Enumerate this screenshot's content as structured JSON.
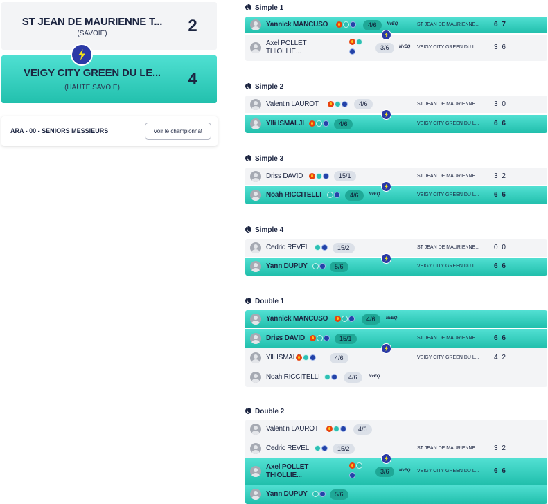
{
  "home_team": {
    "name": "ST JEAN DE MAURIENNE T...",
    "region": "(SAVOIE)",
    "score": "2"
  },
  "away_team": {
    "name": "VEIGY CITY GREEN DU LE...",
    "region": "(HAUTE SAVOIE)",
    "score": "4"
  },
  "championship": {
    "label": "ARA - 00 - SENIORS MESSIEURS",
    "button": "Voir le championnat"
  },
  "clubs": {
    "home": "ST JEAN DE MAURIENNE TENNIS",
    "away": "VEIGY CITY GREEN DU LEMAN"
  },
  "icons": {
    "badge": "lightning-bolt-icon",
    "fire": "fire-icon",
    "teal": "teal-circle-icon",
    "blue": "blue-circle-icon",
    "sport": "tennis-ball-icon"
  },
  "colors": {
    "winner": "#2ad0be",
    "badge": "#2b3aa7",
    "neutral": "#f3f4f6"
  },
  "matches": [
    {
      "title": "Simple 1",
      "players": [
        {
          "name": "Yannick MANCUSO",
          "rank": "4/6",
          "nveq": "NvEQ",
          "icons": [
            "fire",
            "teal",
            "blue"
          ]
        },
        {
          "name": "Axel POLLET THIOLLIE...",
          "rank": "3/6",
          "nveq": "NvEQ",
          "icons": [
            "fire",
            "teal",
            "blue"
          ]
        }
      ],
      "sets": {
        "top": "6 7",
        "bottom": "3 6"
      }
    },
    {
      "title": "Simple 2",
      "players": [
        {
          "name": "Valentin LAUROT",
          "rank": "4/6",
          "nveq": "",
          "icons": [
            "fire",
            "teal",
            "blue"
          ]
        },
        {
          "name": "Ylli ISMALJI",
          "rank": "4/6",
          "nveq": "",
          "icons": [
            "fire",
            "teal",
            "blue"
          ]
        }
      ],
      "sets": {
        "top": "3 0",
        "bottom": "6 6"
      }
    },
    {
      "title": "Simple 3",
      "players": [
        {
          "name": "Driss DAVID",
          "rank": "15/1",
          "nveq": "",
          "icons": [
            "fire",
            "teal",
            "blue"
          ]
        },
        {
          "name": "Noah RICCITELLI",
          "rank": "4/6",
          "nveq": "NvEQ",
          "icons": [
            "teal",
            "blue"
          ]
        }
      ],
      "sets": {
        "top": "3 2",
        "bottom": "6 6"
      }
    },
    {
      "title": "Simple 4",
      "players": [
        {
          "name": "Cedric REVEL",
          "rank": "15/2",
          "nveq": "",
          "icons": [
            "teal",
            "blue"
          ]
        },
        {
          "name": "Yann DUPUY",
          "rank": "5/6",
          "nveq": "",
          "icons": [
            "teal",
            "blue"
          ]
        }
      ],
      "sets": {
        "top": "0 0",
        "bottom": "6 6"
      }
    },
    {
      "title": "Double 1",
      "players": [
        {
          "name": "Yannick MANCUSO",
          "rank": "4/6",
          "nveq": "NvEQ",
          "icons": [
            "fire",
            "teal",
            "blue"
          ]
        },
        {
          "name": "Driss DAVID",
          "rank": "15/1",
          "nveq": "",
          "icons": [
            "fire",
            "teal",
            "blue"
          ]
        },
        {
          "name": "Ylli ISMALJI",
          "rank": "4/6",
          "nveq": "",
          "icons": [
            "fire",
            "teal",
            "blue"
          ]
        },
        {
          "name": "Noah RICCITELLI",
          "rank": "4/6",
          "nveq": "NvEQ",
          "icons": [
            "teal",
            "blue"
          ]
        }
      ],
      "sets": {
        "top": "6 6",
        "bottom": "4 2"
      }
    },
    {
      "title": "Double 2",
      "players": [
        {
          "name": "Valentin LAUROT",
          "rank": "4/6",
          "nveq": "",
          "icons": [
            "fire",
            "teal",
            "blue"
          ]
        },
        {
          "name": "Cedric REVEL",
          "rank": "15/2",
          "nveq": "",
          "icons": [
            "teal",
            "blue"
          ]
        },
        {
          "name": "Axel POLLET THIOLLIE...",
          "rank": "3/6",
          "nveq": "NvEQ",
          "icons": [
            "fire",
            "teal",
            "blue"
          ]
        },
        {
          "name": "Yann DUPUY",
          "rank": "5/6",
          "nveq": "",
          "icons": [
            "teal",
            "blue"
          ]
        }
      ],
      "sets": {
        "top": "3 2",
        "bottom": "6 6"
      }
    }
  ]
}
